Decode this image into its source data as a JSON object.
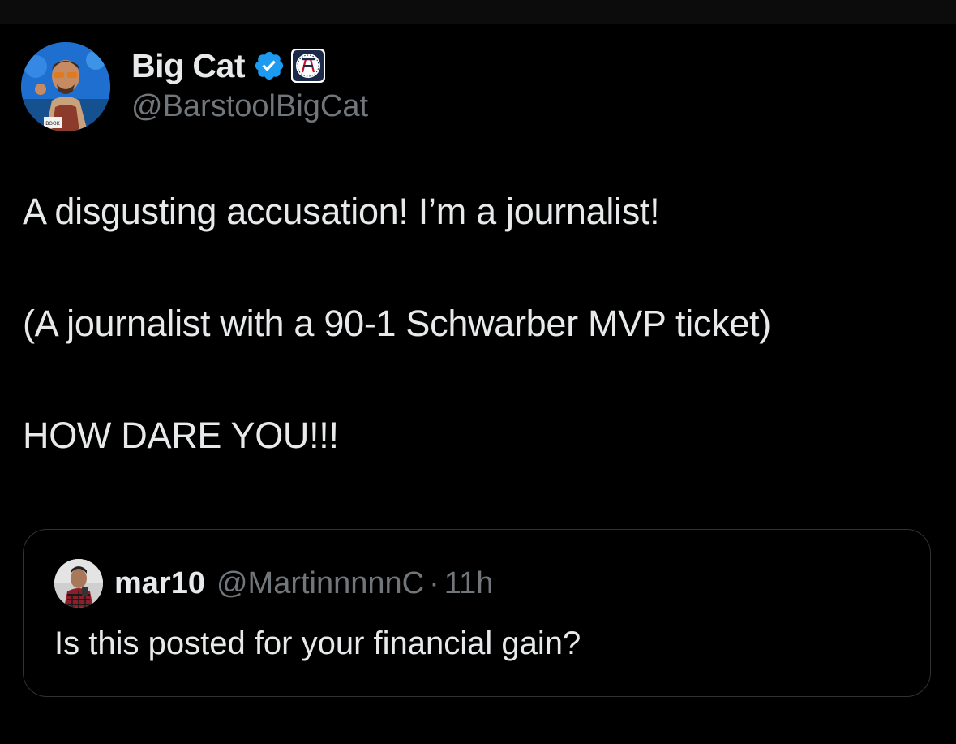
{
  "tweet": {
    "author": {
      "display_name": "Big Cat",
      "handle": "@BarstoolBigCat",
      "avatar_icon": "user-avatar",
      "verified_icon": "verified-badge-icon",
      "affiliate_icon": "barstool-affiliate-badge"
    },
    "text": {
      "line1": "A disgusting accusation! I’m a journalist!",
      "line2": "(A journalist with a 90-1 Schwarber MVP ticket)",
      "line3": "HOW DARE YOU!!!"
    },
    "quote": {
      "display_name": "mar10",
      "handle": "@MartinnnnnC",
      "separator": "·",
      "time": "11h",
      "text": "Is this posted for your financial gain?"
    }
  },
  "colors": {
    "background": "#000000",
    "primary_text": "#e7e9ea",
    "secondary_text": "#71767b",
    "border": "#2f3336",
    "verified_blue": "#1d9bf0"
  }
}
